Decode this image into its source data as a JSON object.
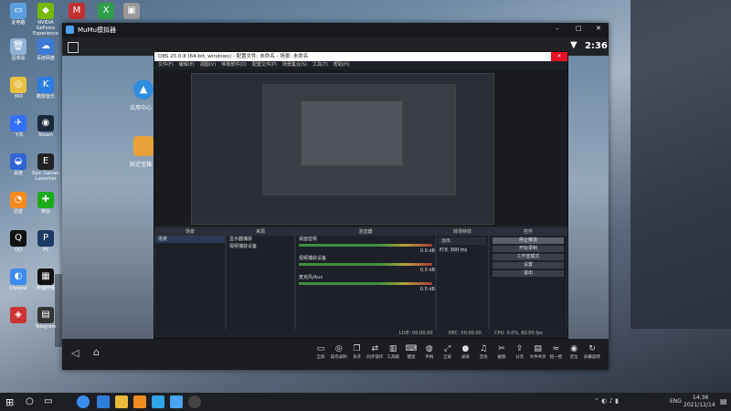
{
  "desktop": {
    "icons": [
      {
        "label": "此电脑",
        "color": "#5aa0e0",
        "glyph": "▭"
      },
      {
        "label": "NVIDIA\nGeForce\nExperience",
        "color": "#76b900",
        "glyph": "◆"
      },
      {
        "label": "",
        "color": "#c23030",
        "glyph": "M"
      },
      {
        "label": "",
        "color": "#2f9e4b",
        "glyph": "X"
      },
      {
        "label": "",
        "color": "#999",
        "glyph": "▣"
      },
      {
        "label": "回收站",
        "color": "#8fb3d6",
        "glyph": "🗑"
      },
      {
        "label": "百度网盘",
        "color": "#3a7bd5",
        "glyph": "☁"
      },
      {
        "label": "360",
        "color": "#e8c040",
        "glyph": "◎"
      },
      {
        "label": "酷狗音乐",
        "color": "#2a7de1",
        "glyph": "K"
      },
      {
        "label": "飞书",
        "color": "#3370ff",
        "glyph": "✈"
      },
      {
        "label": "Steam",
        "color": "#1b2838",
        "glyph": "◉"
      },
      {
        "label": "百度",
        "color": "#2e64d6",
        "glyph": "◒"
      },
      {
        "label": "Epic Games\nLauncher",
        "color": "#222",
        "glyph": "E"
      },
      {
        "label": "迅雷",
        "color": "#f38b1f",
        "glyph": "◔"
      },
      {
        "label": "微信",
        "color": "#1aad19",
        "glyph": "✚"
      },
      {
        "label": "QQ",
        "color": "#111",
        "glyph": "Q"
      },
      {
        "label": "PS",
        "color": "#1d3a64",
        "glyph": "P"
      },
      {
        "label": "Chrome",
        "color": "#3b8cf0",
        "glyph": "◐"
      },
      {
        "label": "哔哩哔哩",
        "color": "#111",
        "glyph": "▦"
      },
      {
        "label": "",
        "color": "#c33",
        "glyph": "◈"
      },
      {
        "label": "Telegram",
        "color": "#333",
        "glyph": "▤"
      }
    ]
  },
  "emulator": {
    "title": "MuMu模拟器",
    "clock": "2:36",
    "app_label": "应用中心",
    "app2_label": "跃迁宝箱",
    "toolbar": [
      {
        "label": "全屏",
        "glyph": "▭"
      },
      {
        "label": "操作录制",
        "glyph": "◎"
      },
      {
        "label": "多开",
        "glyph": "❐"
      },
      {
        "label": "同步操作",
        "glyph": "⇄"
      },
      {
        "label": "工具箱",
        "glyph": "▥"
      },
      {
        "label": "键鼠",
        "glyph": "⌨"
      },
      {
        "label": "手柄",
        "glyph": "◍"
      },
      {
        "label": "全屏",
        "glyph": "⤢"
      },
      {
        "label": "录屏",
        "glyph": "●"
      },
      {
        "label": "音效",
        "glyph": "♫"
      },
      {
        "label": "截图",
        "glyph": "✂"
      },
      {
        "label": "分享",
        "glyph": "⇪"
      },
      {
        "label": "文件共享",
        "glyph": "▤"
      },
      {
        "label": "摇一摇",
        "glyph": "≈"
      },
      {
        "label": "定位",
        "glyph": "◉"
      },
      {
        "label": "屏幕旋转",
        "glyph": "↻"
      }
    ]
  },
  "obs": {
    "title": "OBS 25.0.8 (64-bit, windows) - 配置文件: 未命名 - 场景: 未命名",
    "menu": [
      "文件(F)",
      "编辑(E)",
      "视图(V)",
      "停靠部件(D)",
      "配置文件(P)",
      "场景集合(S)",
      "工具(T)",
      "帮助(H)"
    ],
    "docks": {
      "scenes": {
        "header": "场景",
        "items": [
          "场景"
        ]
      },
      "sources": {
        "header": "来源",
        "items": [
          "显示器捕获",
          "视频捕获设备"
        ]
      },
      "mixer": {
        "header": "混音器",
        "channels": [
          {
            "name": "桌面音频",
            "level": "0.0 dB"
          },
          {
            "name": "视频捕获设备",
            "level": "0.0 dB"
          },
          {
            "name": "麦克风/Aux",
            "level": "0.0 dB"
          }
        ]
      },
      "transitions": {
        "header": "转场特效",
        "type": "淡出",
        "duration_label": "时长",
        "duration_value": "300 ms"
      },
      "controls": {
        "header": "控件",
        "buttons": [
          "停止推流",
          "开始录制",
          "工作室模式",
          "设置",
          "退出"
        ]
      }
    },
    "status": {
      "live": "LIVE: 00:00:00",
      "rec": "REC: 00:00:00",
      "cpu": "CPU: 0.0%, 60.00 fps"
    }
  },
  "taskbar": {
    "time": "14:36",
    "date": "2021/12/14",
    "lang": "ENG"
  }
}
